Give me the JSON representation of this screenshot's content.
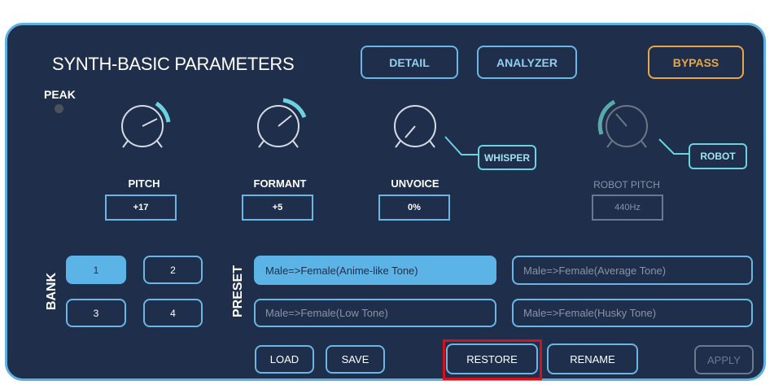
{
  "title": "SYNTH-BASIC PARAMETERS",
  "top_buttons": {
    "detail": "DETAIL",
    "analyzer": "ANALYZER",
    "bypass": "BYPASS"
  },
  "peak_label": "PEAK",
  "knobs": {
    "pitch": {
      "label": "PITCH",
      "value": "+17"
    },
    "formant": {
      "label": "FORMANT",
      "value": "+5"
    },
    "unvoice": {
      "label": "UNVOICE",
      "value": "0%"
    },
    "robot_pitch": {
      "label": "ROBOT PITCH",
      "value": "440Hz"
    }
  },
  "toggles": {
    "whisper": "WHISPER",
    "robot": "ROBOT"
  },
  "bank": {
    "label": "BANK",
    "items": [
      "1",
      "2",
      "3",
      "4"
    ],
    "selected": "1"
  },
  "preset": {
    "label": "PRESET",
    "items": [
      "Male=>Female(Anime-like Tone)",
      "Male=>Female(Average Tone)",
      "Male=>Female(Low Tone)",
      "Male=>Female(Husky Tone)"
    ],
    "selected": "Male=>Female(Anime-like Tone)"
  },
  "bottom_buttons": {
    "load": "LOAD",
    "save": "SAVE",
    "restore": "RESTORE",
    "rename": "RENAME",
    "apply": "APPLY"
  },
  "colors": {
    "panel": "#1f2e4a",
    "accent": "#5cb3e6",
    "teal": "#6ad2e0",
    "bypass": "#e8a647",
    "highlight": "#d0141e"
  }
}
